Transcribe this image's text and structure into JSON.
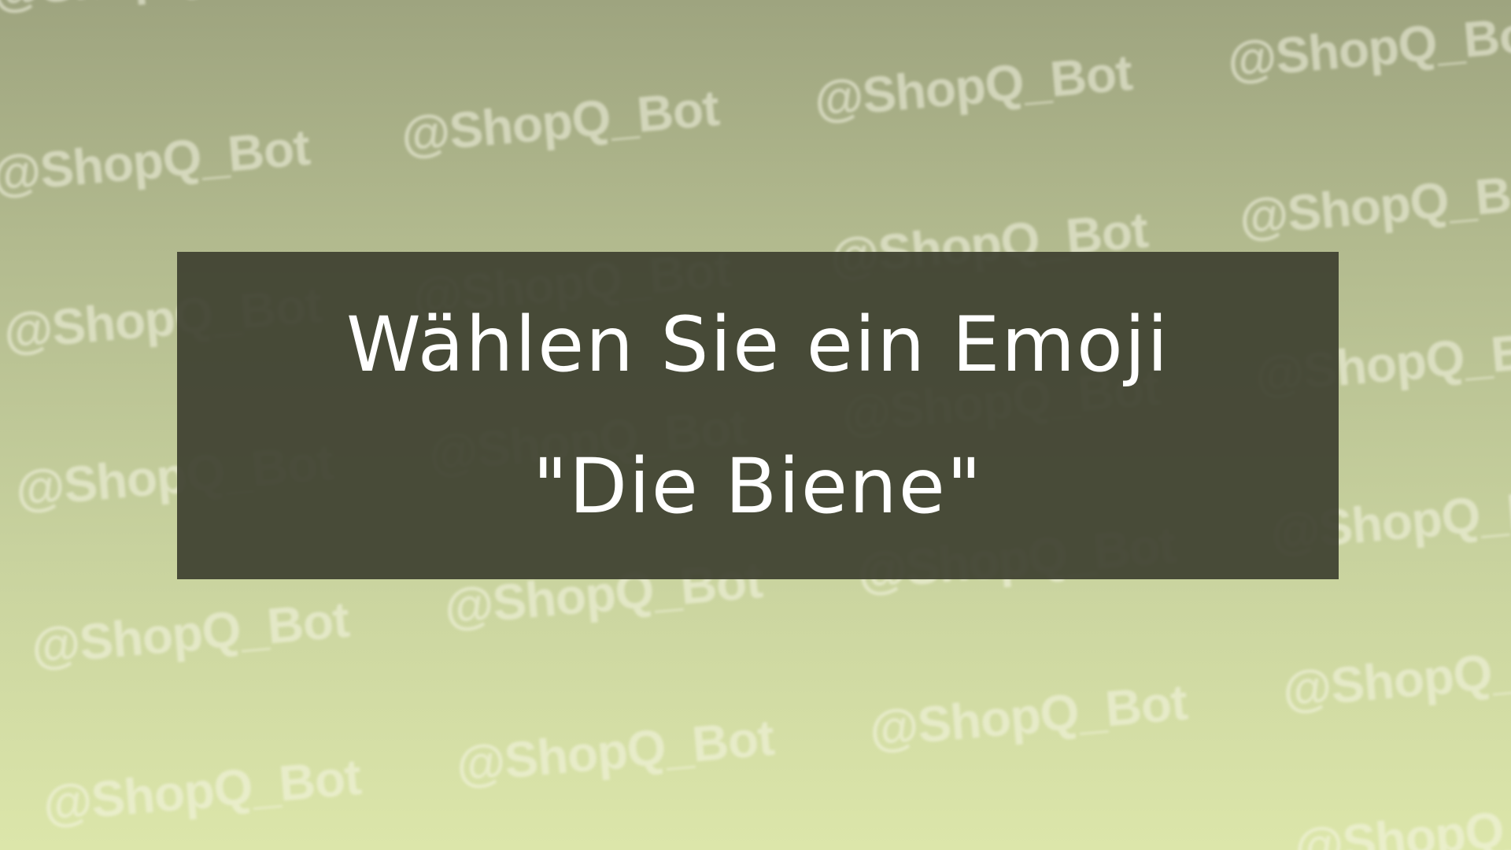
{
  "watermark": {
    "text": "@ShopQ_Bot"
  },
  "card": {
    "title": "Wählen Sie ein Emoji",
    "subtitle": "\"Die Biene\""
  }
}
